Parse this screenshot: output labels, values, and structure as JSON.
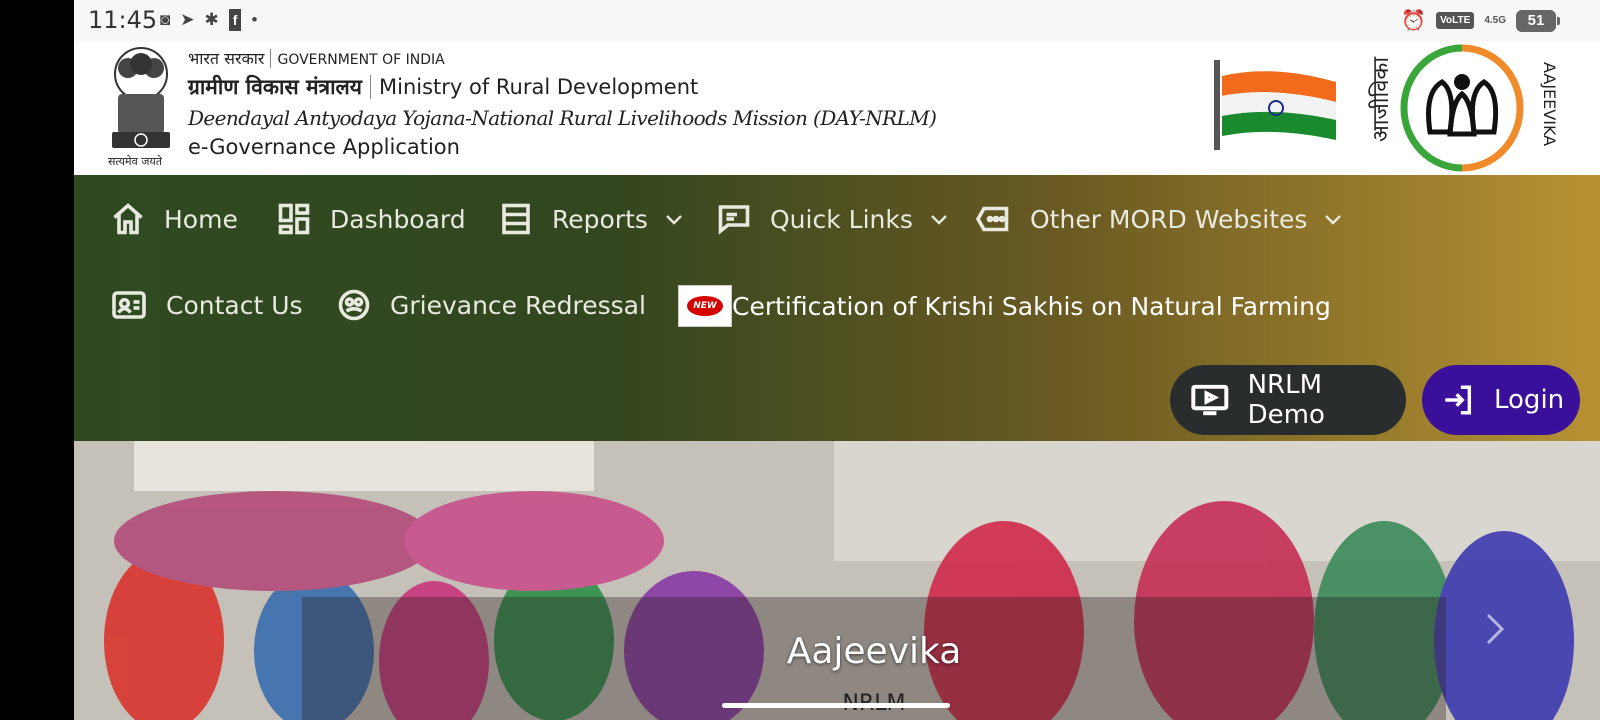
{
  "status_bar": {
    "time": "11:45",
    "left_icons": [
      "nfc-icon",
      "telegram-icon",
      "bug-icon",
      "facebook-icon",
      "dot-icon"
    ],
    "volte": "VoLTE",
    "network": "4.5G",
    "battery": "51"
  },
  "header": {
    "gov_hindi": "भारत सरकार",
    "gov_english": "GOVERNMENT OF INDIA",
    "ministry_hindi": "ग्रामीण विकास मंत्रालय",
    "ministry_english": "Ministry of Rural Development",
    "mission": "Deendayal Antyodaya Yojana-National Rural Livelihoods Mission (DAY-NRLM)",
    "app": "e-Governance Application",
    "emblem_motto": "सत्यमेव जयते",
    "logo_text_hindi": "आजीविका",
    "logo_text_english": "AAJEEVIKA"
  },
  "nav": {
    "items": [
      {
        "label": "Home",
        "icon": "home-icon"
      },
      {
        "label": "Dashboard",
        "icon": "dashboard-icon"
      },
      {
        "label": "Reports",
        "icon": "reports-icon"
      },
      {
        "label": "Quick Links",
        "icon": "quick-links-icon"
      },
      {
        "label": "Other MORD Websites",
        "icon": "websites-icon"
      },
      {
        "label": "Contact Us",
        "icon": "contact-icon"
      },
      {
        "label": "Grievance Redressal",
        "icon": "grievance-icon"
      }
    ],
    "new_badge": "NEW",
    "announcement": "Certification of Krishi Sakhis on Natural Farming"
  },
  "buttons": {
    "demo": "NRLM Demo",
    "login": "Login"
  },
  "hero": {
    "title": "Aajeevika",
    "subtitle": "NRLM"
  },
  "colors": {
    "nav_start": "#2f4a22",
    "nav_end": "#b79233",
    "login_bg": "#3a0f9a",
    "demo_bg": "#2a2d2e"
  }
}
